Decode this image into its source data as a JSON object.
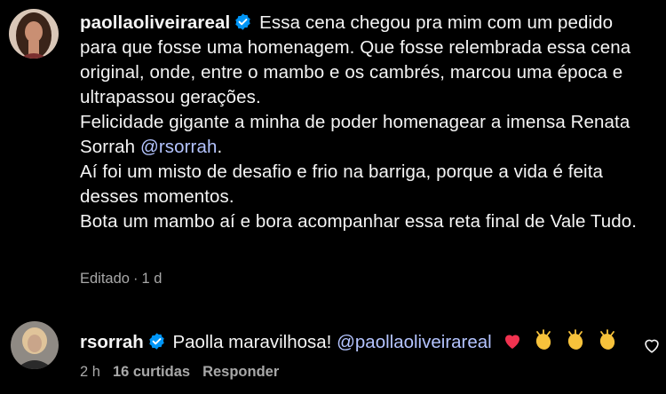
{
  "post": {
    "username": "paollaoliveirareal",
    "caption_lines": [
      "Essa cena chegou pra mim com um pedido para que fosse uma homenagem. Que fosse relembrada essa cena original, onde, entre o mambo e os cambrés, marcou uma época e ultrapassou gerações.",
      "Felicidade gigante a minha de poder homenagear a imensa Renata Sorrah ",
      "Aí foi um misto de desafio e frio na barriga, porque a vida é feita desses momentos.",
      "Bota um mambo aí e bora acompanhar essa reta final de Vale Tudo."
    ],
    "mention": "@rsorrah",
    "mention_suffix": ".",
    "meta_edited": "Editado",
    "meta_sep": "·",
    "meta_time": "1 d"
  },
  "reply": {
    "username": "rsorrah",
    "text": "Paolla maravilhosa! ",
    "mention": "@paollaoliveirareal",
    "time": "2 h",
    "likes": "16 curtidas",
    "reply_label": "Responder"
  },
  "icons": {
    "verified": "verified-badge-icon",
    "heart": "heart-outline-icon",
    "emoji_heart": "red-heart-emoji",
    "emoji_clap": "clapping-hands-emoji"
  },
  "colors": {
    "background": "#000000",
    "text": "#f5f5f5",
    "muted": "#a8a8a8",
    "mention": "#b4c4ff",
    "verified": "#0095f6"
  }
}
